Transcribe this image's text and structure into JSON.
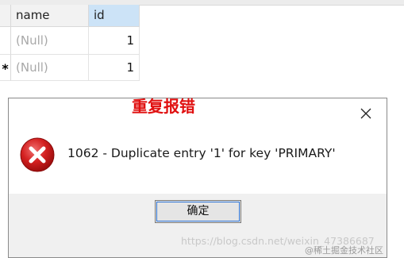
{
  "grid": {
    "columns": [
      "name",
      "id"
    ],
    "rows": [
      {
        "marker": "",
        "name": "(Null)",
        "id": "1"
      },
      {
        "marker": "*",
        "name": "(Null)",
        "id": "1"
      }
    ]
  },
  "annotation": "重复报错",
  "dialog": {
    "close_label": "✕",
    "icon": "error-icon",
    "message": "1062 - Duplicate entry '1' for key 'PRIMARY'",
    "ok_label": "确定"
  },
  "watermark": {
    "url": "https://blog.csdn.net/weixin_47386687",
    "credit": "@稀土掘金技术社区"
  },
  "colors": {
    "error_red": "#d42020",
    "annotation_red": "#e01010",
    "selected_header": "#cce3f7",
    "focus_blue": "#2e74d6"
  }
}
